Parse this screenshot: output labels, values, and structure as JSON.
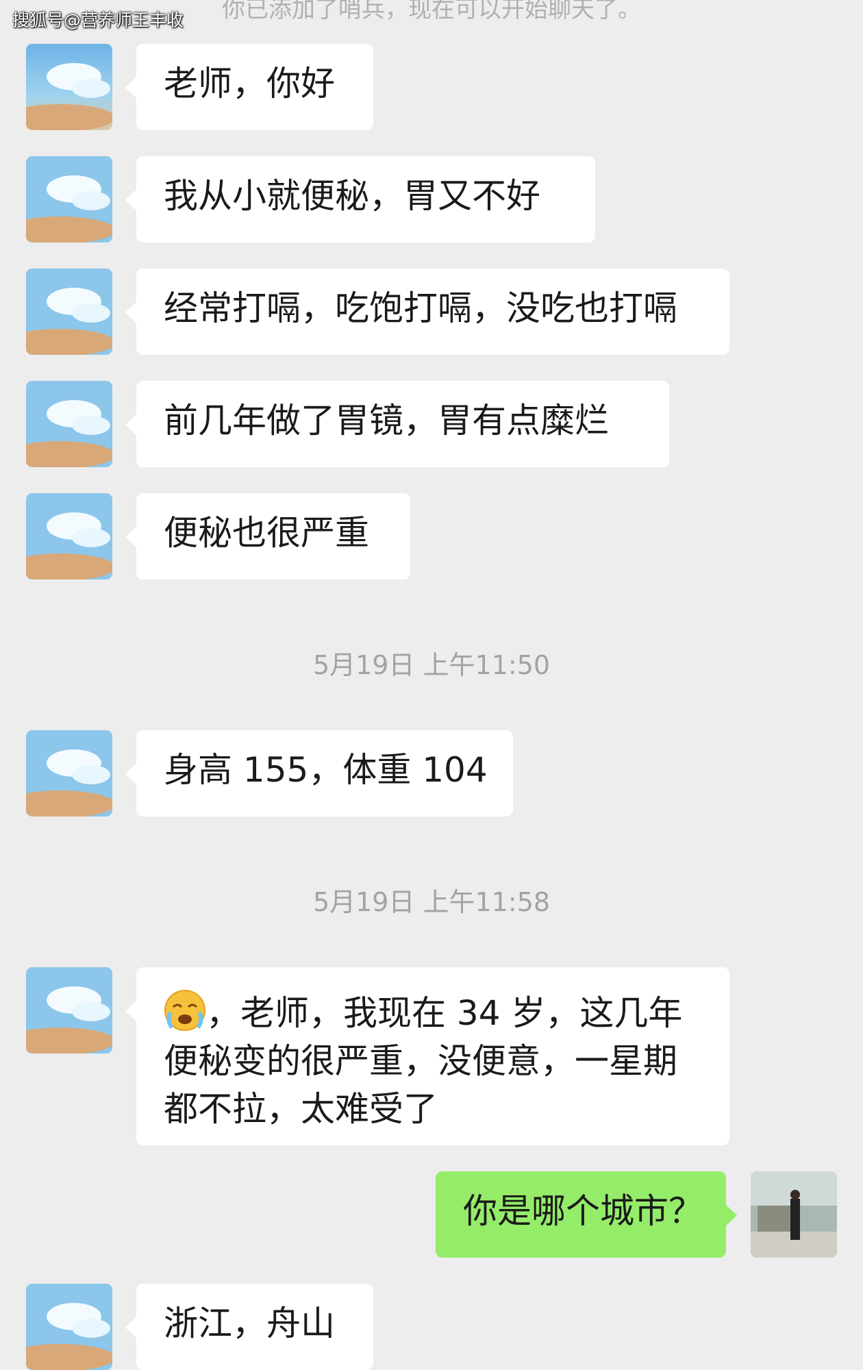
{
  "watermark": "搜狐号@营养师王丰收",
  "top_cut_text": "你已添加了哨兵，现在可以开始聊天了。",
  "messages": [
    {
      "text": "老师，你好"
    },
    {
      "text": "我从小就便秘，胃又不好"
    },
    {
      "text": "经常打嗝，吃饱打嗝，没吃也打嗝"
    },
    {
      "text": "前几年做了胃镜，胃有点糜烂"
    },
    {
      "text": "便秘也很严重"
    },
    {
      "text": "身高 155，体重 104"
    },
    {
      "text": "，老师，我现在 34 岁，这几年便秘变的很严重，没便意，一星期都不拉，太难受了",
      "emoji": "crying-face-emoji"
    },
    {
      "text": "你是哪个城市？"
    },
    {
      "text": "浙江，舟山"
    }
  ],
  "timestamps": [
    "5月19日 上午11:50",
    "5月19日 上午11:58"
  ],
  "colors": {
    "background": "#ededed",
    "incoming_bubble": "#ffffff",
    "outgoing_bubble": "#95ec69",
    "timestamp": "#a3a3a3"
  }
}
